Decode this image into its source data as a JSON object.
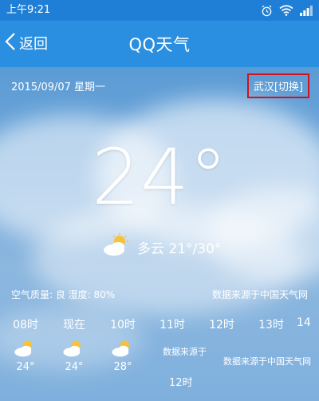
{
  "status_bar": {
    "time": "上午9:21",
    "icons": [
      "alarm-icon",
      "wifi-icon",
      "signal-icon"
    ]
  },
  "title_bar": {
    "back_label": "返回",
    "title": "QQ天气"
  },
  "weather": {
    "date": "2015/09/07 星期一",
    "city_switch": "武汉[切换]",
    "temperature": "24°",
    "condition": "多云 21°/30°",
    "air_quality": "空气质量: 良  湿度: 80%",
    "source": "数据来源于中国天气网"
  },
  "hourly": [
    {
      "label": "08时",
      "temp": "24°",
      "icon": "partly-cloudy-icon"
    },
    {
      "label": "现在",
      "temp": "24°",
      "icon": "partly-cloudy-icon"
    },
    {
      "label": "10时",
      "temp": "28°",
      "icon": "partly-cloudy-icon"
    },
    {
      "label": "11时",
      "temp": "",
      "icon": ""
    },
    {
      "label": "12时",
      "temp": "",
      "icon": ""
    },
    {
      "label": "13时",
      "temp": "",
      "icon": ""
    },
    {
      "label": "14",
      "temp": "",
      "icon": ""
    }
  ],
  "hourly_source_fragments": {
    "a": "数据来源于",
    "b": "数据来源于中国天气网",
    "c": "12时"
  },
  "colors": {
    "title_bar": "#2a8fe0",
    "status_bar": "#1f7fd6",
    "highlight_box": "#d0121b"
  }
}
